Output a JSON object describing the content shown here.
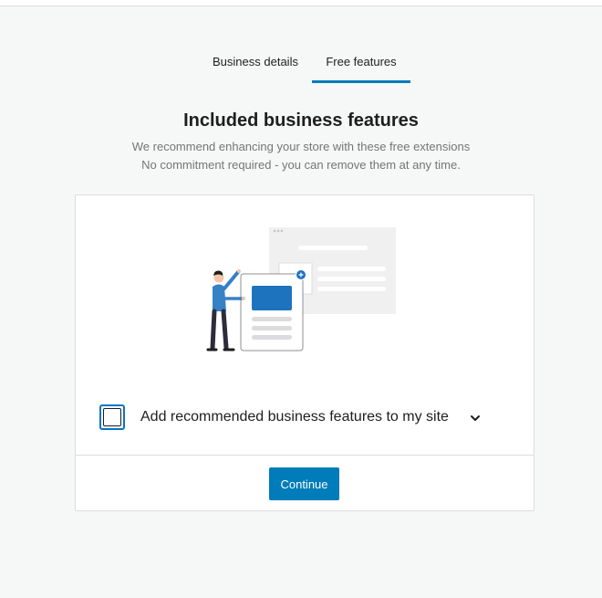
{
  "tabs": [
    {
      "label": "Business details",
      "active": false
    },
    {
      "label": "Free features",
      "active": true
    }
  ],
  "page": {
    "title": "Included business features",
    "subtitle_line1": "We recommend enhancing your store with these free extensions",
    "subtitle_line2": "No commitment required - you can remove them at any time."
  },
  "card": {
    "option_label": "Add recommended business features to my site",
    "option_checked": false,
    "continue_label": "Continue"
  },
  "colors": {
    "accent": "#007cba",
    "background": "#f6f7f7",
    "illustration_shirt": "#3582c4",
    "illustration_card_blue": "#1e73be"
  },
  "icons": [
    "chevron-down-icon",
    "plus-icon",
    "person-illustration"
  ]
}
